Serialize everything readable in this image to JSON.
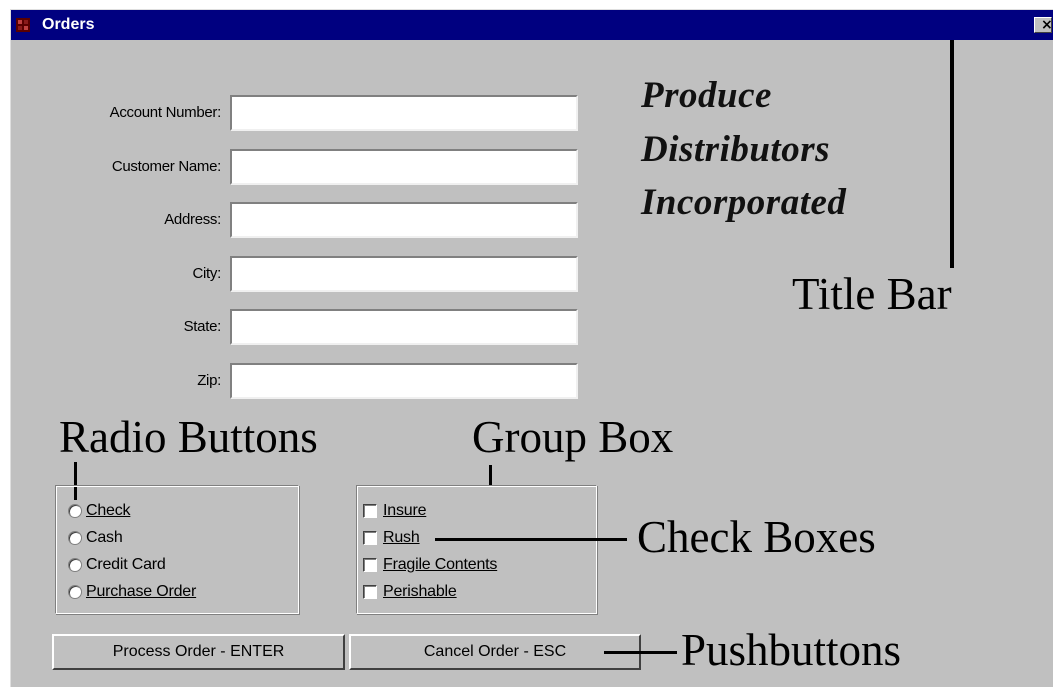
{
  "window": {
    "title": "Orders",
    "close_glyph": "×",
    "title_bar_color": "#000080",
    "face_color": "#c0c0c0",
    "app_icon": "orders-app-icon"
  },
  "form": {
    "fields": [
      {
        "label": "Account Number:",
        "value": ""
      },
      {
        "label": "Customer Name:",
        "value": ""
      },
      {
        "label": "Address:",
        "value": ""
      },
      {
        "label": "City:",
        "value": ""
      },
      {
        "label": "State:",
        "value": ""
      },
      {
        "label": "Zip:",
        "value": ""
      }
    ]
  },
  "company": {
    "line1": "Produce",
    "line2": "Distributors",
    "line3": "Incorporated"
  },
  "payment_options": [
    {
      "label": "Check",
      "selected": false
    },
    {
      "label": "Cash",
      "selected": false
    },
    {
      "label": "Credit Card",
      "selected": false
    },
    {
      "label": "Purchase Order",
      "selected": false
    }
  ],
  "order_options": [
    {
      "label": "Insure",
      "checked": false
    },
    {
      "label": "Rush",
      "checked": false
    },
    {
      "label": "Fragile Contents",
      "checked": false
    },
    {
      "label": "Perishable",
      "checked": false
    }
  ],
  "buttons": {
    "process": "Process Order - ENTER",
    "cancel": "Cancel Order - ESC"
  },
  "callouts": {
    "title_bar": "Title Bar",
    "radio_buttons": "Radio Buttons",
    "group_box": "Group Box",
    "check_boxes": "Check Boxes",
    "pushbuttons": "Pushbuttons"
  }
}
